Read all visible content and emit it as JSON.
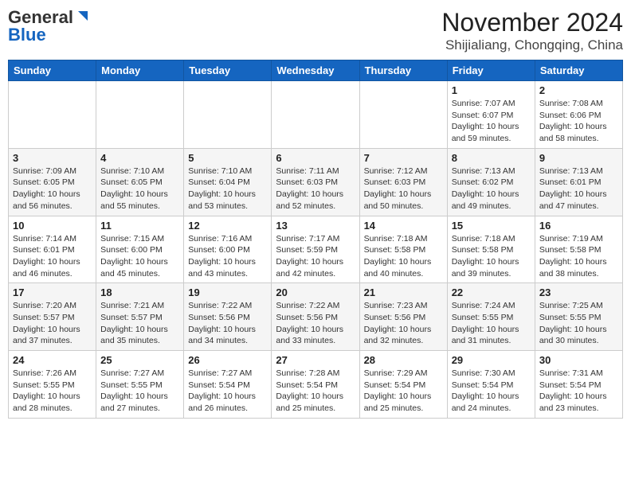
{
  "header": {
    "logo_general": "General",
    "logo_blue": "Blue",
    "title": "November 2024",
    "subtitle": "Shijialiang, Chongqing, China"
  },
  "days_of_week": [
    "Sunday",
    "Monday",
    "Tuesday",
    "Wednesday",
    "Thursday",
    "Friday",
    "Saturday"
  ],
  "weeks": [
    [
      {
        "day": "",
        "info": ""
      },
      {
        "day": "",
        "info": ""
      },
      {
        "day": "",
        "info": ""
      },
      {
        "day": "",
        "info": ""
      },
      {
        "day": "",
        "info": ""
      },
      {
        "day": "1",
        "info": "Sunrise: 7:07 AM\nSunset: 6:07 PM\nDaylight: 10 hours and 59 minutes."
      },
      {
        "day": "2",
        "info": "Sunrise: 7:08 AM\nSunset: 6:06 PM\nDaylight: 10 hours and 58 minutes."
      }
    ],
    [
      {
        "day": "3",
        "info": "Sunrise: 7:09 AM\nSunset: 6:05 PM\nDaylight: 10 hours and 56 minutes."
      },
      {
        "day": "4",
        "info": "Sunrise: 7:10 AM\nSunset: 6:05 PM\nDaylight: 10 hours and 55 minutes."
      },
      {
        "day": "5",
        "info": "Sunrise: 7:10 AM\nSunset: 6:04 PM\nDaylight: 10 hours and 53 minutes."
      },
      {
        "day": "6",
        "info": "Sunrise: 7:11 AM\nSunset: 6:03 PM\nDaylight: 10 hours and 52 minutes."
      },
      {
        "day": "7",
        "info": "Sunrise: 7:12 AM\nSunset: 6:03 PM\nDaylight: 10 hours and 50 minutes."
      },
      {
        "day": "8",
        "info": "Sunrise: 7:13 AM\nSunset: 6:02 PM\nDaylight: 10 hours and 49 minutes."
      },
      {
        "day": "9",
        "info": "Sunrise: 7:13 AM\nSunset: 6:01 PM\nDaylight: 10 hours and 47 minutes."
      }
    ],
    [
      {
        "day": "10",
        "info": "Sunrise: 7:14 AM\nSunset: 6:01 PM\nDaylight: 10 hours and 46 minutes."
      },
      {
        "day": "11",
        "info": "Sunrise: 7:15 AM\nSunset: 6:00 PM\nDaylight: 10 hours and 45 minutes."
      },
      {
        "day": "12",
        "info": "Sunrise: 7:16 AM\nSunset: 6:00 PM\nDaylight: 10 hours and 43 minutes."
      },
      {
        "day": "13",
        "info": "Sunrise: 7:17 AM\nSunset: 5:59 PM\nDaylight: 10 hours and 42 minutes."
      },
      {
        "day": "14",
        "info": "Sunrise: 7:18 AM\nSunset: 5:58 PM\nDaylight: 10 hours and 40 minutes."
      },
      {
        "day": "15",
        "info": "Sunrise: 7:18 AM\nSunset: 5:58 PM\nDaylight: 10 hours and 39 minutes."
      },
      {
        "day": "16",
        "info": "Sunrise: 7:19 AM\nSunset: 5:58 PM\nDaylight: 10 hours and 38 minutes."
      }
    ],
    [
      {
        "day": "17",
        "info": "Sunrise: 7:20 AM\nSunset: 5:57 PM\nDaylight: 10 hours and 37 minutes."
      },
      {
        "day": "18",
        "info": "Sunrise: 7:21 AM\nSunset: 5:57 PM\nDaylight: 10 hours and 35 minutes."
      },
      {
        "day": "19",
        "info": "Sunrise: 7:22 AM\nSunset: 5:56 PM\nDaylight: 10 hours and 34 minutes."
      },
      {
        "day": "20",
        "info": "Sunrise: 7:22 AM\nSunset: 5:56 PM\nDaylight: 10 hours and 33 minutes."
      },
      {
        "day": "21",
        "info": "Sunrise: 7:23 AM\nSunset: 5:56 PM\nDaylight: 10 hours and 32 minutes."
      },
      {
        "day": "22",
        "info": "Sunrise: 7:24 AM\nSunset: 5:55 PM\nDaylight: 10 hours and 31 minutes."
      },
      {
        "day": "23",
        "info": "Sunrise: 7:25 AM\nSunset: 5:55 PM\nDaylight: 10 hours and 30 minutes."
      }
    ],
    [
      {
        "day": "24",
        "info": "Sunrise: 7:26 AM\nSunset: 5:55 PM\nDaylight: 10 hours and 28 minutes."
      },
      {
        "day": "25",
        "info": "Sunrise: 7:27 AM\nSunset: 5:55 PM\nDaylight: 10 hours and 27 minutes."
      },
      {
        "day": "26",
        "info": "Sunrise: 7:27 AM\nSunset: 5:54 PM\nDaylight: 10 hours and 26 minutes."
      },
      {
        "day": "27",
        "info": "Sunrise: 7:28 AM\nSunset: 5:54 PM\nDaylight: 10 hours and 25 minutes."
      },
      {
        "day": "28",
        "info": "Sunrise: 7:29 AM\nSunset: 5:54 PM\nDaylight: 10 hours and 25 minutes."
      },
      {
        "day": "29",
        "info": "Sunrise: 7:30 AM\nSunset: 5:54 PM\nDaylight: 10 hours and 24 minutes."
      },
      {
        "day": "30",
        "info": "Sunrise: 7:31 AM\nSunset: 5:54 PM\nDaylight: 10 hours and 23 minutes."
      }
    ]
  ]
}
